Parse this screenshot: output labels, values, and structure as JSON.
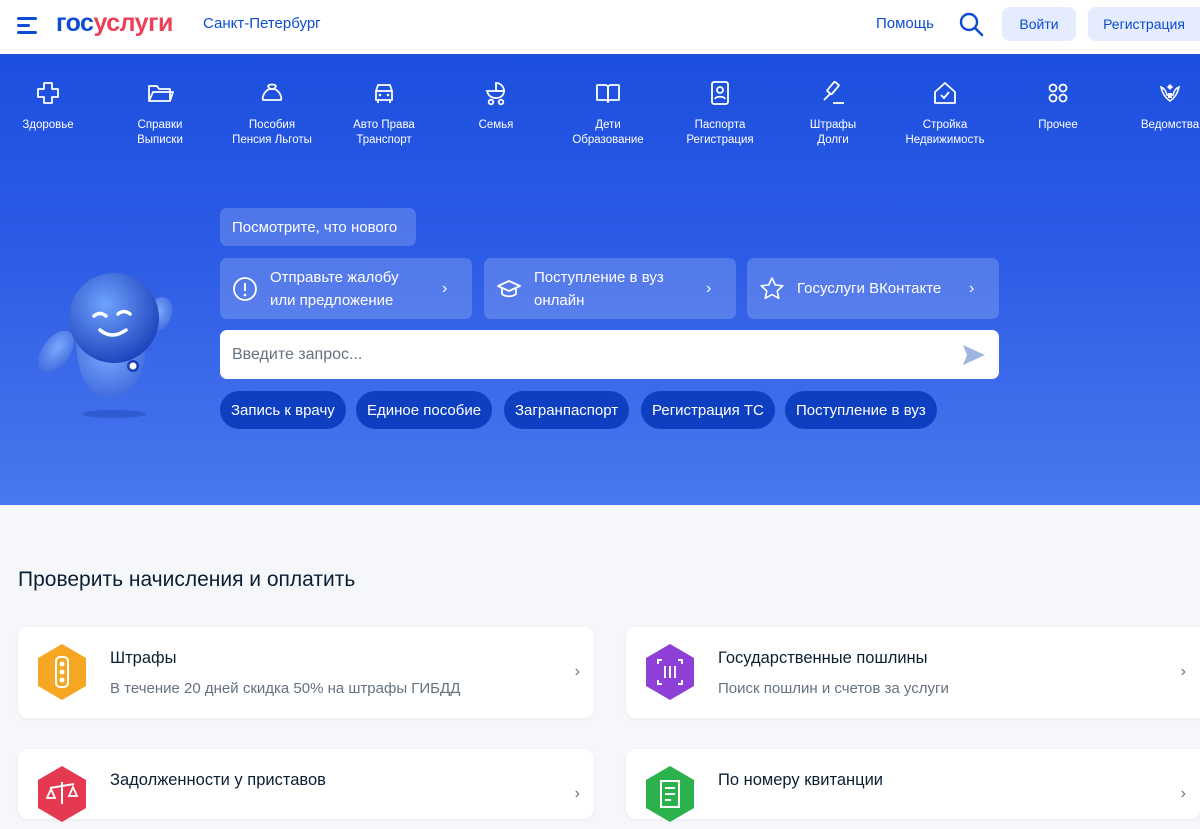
{
  "header": {
    "logo_part1": "гос",
    "logo_part2": "услуги",
    "city": "Санкт-Петербург",
    "help": "Помощь",
    "login": "Войти",
    "register": "Регистрация"
  },
  "categories": [
    {
      "line1": "Здоровье",
      "line2": ""
    },
    {
      "line1": "Справки",
      "line2": "Выписки"
    },
    {
      "line1": "Пособия",
      "line2": "Пенсия Льготы"
    },
    {
      "line1": "Авто Права",
      "line2": "Транспорт"
    },
    {
      "line1": "Семья",
      "line2": ""
    },
    {
      "line1": "Дети",
      "line2": "Образование"
    },
    {
      "line1": "Паспорта",
      "line2": "Регистрация"
    },
    {
      "line1": "Штрафы",
      "line2": "Долги"
    },
    {
      "line1": "Стройка",
      "line2": "Недвижимость"
    },
    {
      "line1": "Прочее",
      "line2": ""
    },
    {
      "line1": "Ведомства",
      "line2": ""
    }
  ],
  "hero": {
    "news_chip": "Посмотрите, что нового",
    "promos": [
      {
        "line1": "Отправьте жалобу",
        "line2": "или предложение",
        "icon": "exclamation-circle-icon"
      },
      {
        "line1": "Поступление в вуз",
        "line2": "онлайн",
        "icon": "graduation-cap-icon"
      },
      {
        "line1": "Госуслуги ВКонтакте",
        "line2": "",
        "icon": "star-icon"
      }
    ],
    "search_placeholder": "Введите запрос...",
    "quick_links": [
      "Запись к врачу",
      "Единое пособие",
      "Загранпаспорт",
      "Регистрация ТС",
      "Поступление в вуз"
    ]
  },
  "main": {
    "section_title": "Проверить начисления и оплатить",
    "cards": [
      {
        "title": "Штрафы",
        "subtitle": "В течение 20 дней скидка 50% на штрафы ГИБДД",
        "color": "#f5a623",
        "icon": "traffic-light-icon"
      },
      {
        "title": "Государственные пошлины",
        "subtitle": "Поиск пошлин и счетов за услуги",
        "color": "#8e3fd6",
        "icon": "barcode-scan-icon"
      },
      {
        "title": "Задолженности у приставов",
        "subtitle": "",
        "color": "#e53950",
        "icon": "scales-icon"
      },
      {
        "title": "По номеру квитанции",
        "subtitle": "",
        "color": "#2bb24c",
        "icon": "receipt-icon"
      }
    ]
  },
  "colors": {
    "brand_blue": "#0d4cd3",
    "brand_red": "#ee3f58",
    "hero_top": "#1c4fde",
    "hero_bottom": "#4a78ee",
    "chip_dark": "#0e3fc0"
  }
}
